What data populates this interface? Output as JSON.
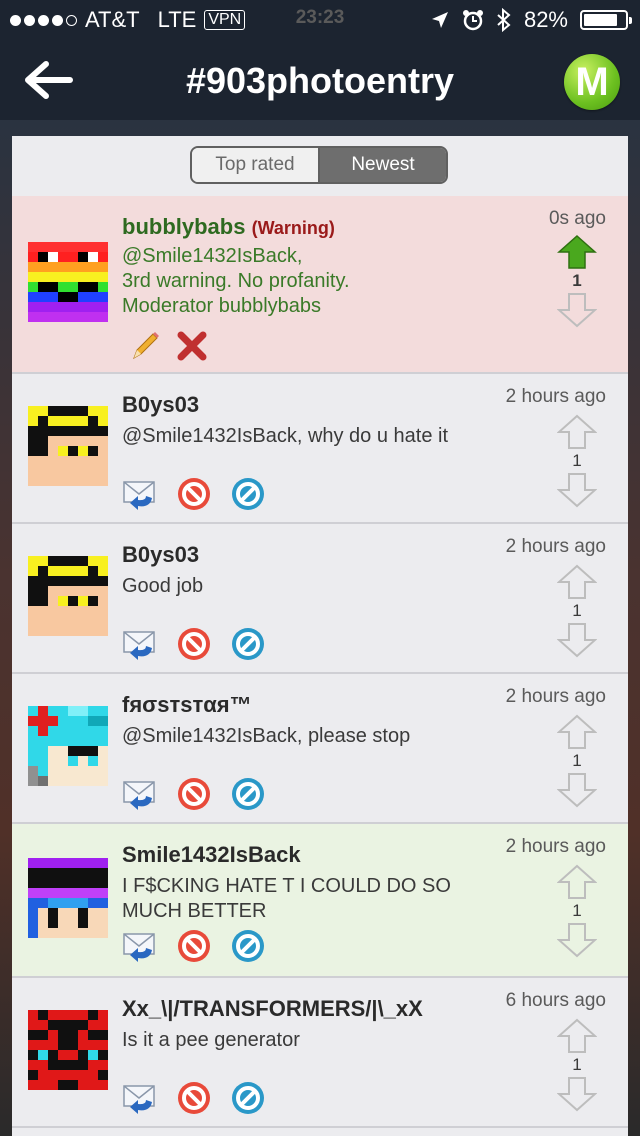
{
  "status_bar": {
    "carrier": "AT&T",
    "network": "LTE",
    "vpn": "VPN",
    "time": "23:23",
    "battery_percent": "82%",
    "battery_level": 0.82,
    "signal_bars": 4
  },
  "nav": {
    "title": "#903photoentry",
    "logo_letter": "M"
  },
  "sort_tabs": {
    "top_rated": "Top rated",
    "newest": "Newest",
    "selected": "newest"
  },
  "comments": [
    {
      "username": "bubblybabs",
      "warning_label": "(Warning)",
      "text_lines": [
        "@Smile1432IsBack,",
        "3rd warning.  No profanity.",
        "Moderator bubblybabs"
      ],
      "time": "0s ago",
      "votes": "1",
      "upvoted": true,
      "actions": [
        "edit-icon",
        "delete-icon"
      ]
    },
    {
      "username": "B0ys03",
      "text": "@Smile1432IsBack, why do u hate it",
      "time": "2 hours ago",
      "votes": "1"
    },
    {
      "username": "B0ys03",
      "text": "Good job",
      "time": "2 hours ago",
      "votes": "1"
    },
    {
      "username": "fяσѕтѕтαя™",
      "text": "@Smile1432IsBack, please stop",
      "time": "2 hours ago",
      "votes": "1"
    },
    {
      "username": "Smile1432IsBack",
      "text": "I F$CKING HATE T I COULD DO SO MUCH BETTER",
      "time": "2 hours ago",
      "votes": "1"
    },
    {
      "username": "Xx_\\|/TRANSFORMERS/|\\_xX",
      "text": "Is it a pee generator",
      "time": "6 hours ago",
      "votes": "1"
    }
  ],
  "colors": {
    "nav_bg": "#1c2430",
    "warning_bg": "#f3dcdc",
    "own_comment_bg": "#eaf3e2",
    "moderator_text": "#2e6a20",
    "warning_label": "#9a1a1a",
    "upvote_green": "#4aa81e"
  }
}
